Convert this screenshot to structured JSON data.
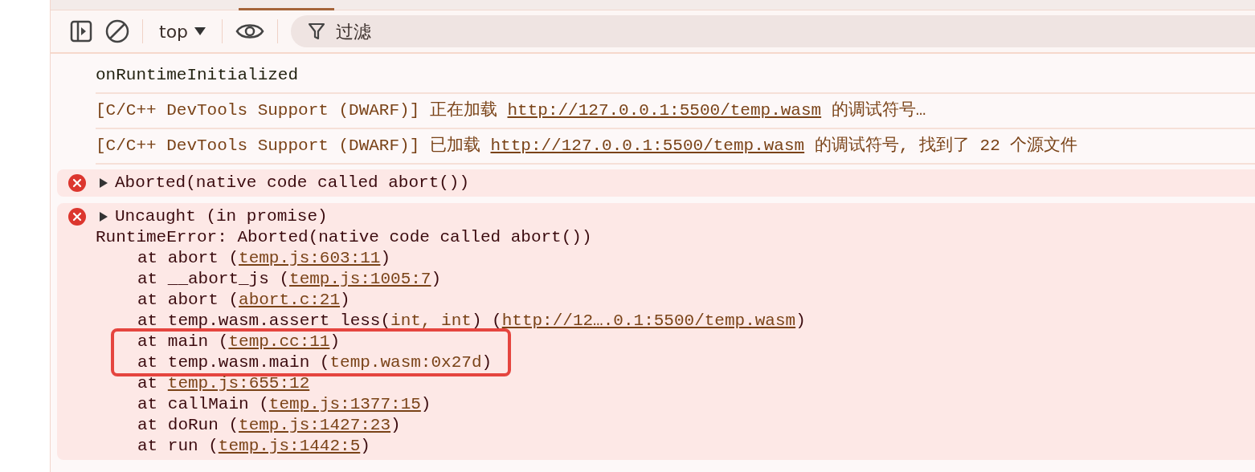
{
  "toolbar": {
    "context": "top",
    "filter": {
      "placeholder": "过滤"
    }
  },
  "messages": [
    {
      "kind": "log",
      "parts": [
        {
          "kind": "text",
          "text": "onRuntimeInitialized"
        }
      ]
    },
    {
      "kind": "system",
      "parts": [
        {
          "kind": "text",
          "text": "[C/C++ DevTools Support (DWARF)] 正在加载 "
        },
        {
          "kind": "link",
          "text": "http://127.0.0.1:5500/temp.wasm"
        },
        {
          "kind": "text",
          "text": " 的调试符号…"
        }
      ]
    },
    {
      "kind": "system",
      "parts": [
        {
          "kind": "text",
          "text": "[C/C++ DevTools Support (DWARF)] 已加载 "
        },
        {
          "kind": "link",
          "text": "http://127.0.0.1:5500/temp.wasm"
        },
        {
          "kind": "text",
          "text": " 的调试符号, 找到了 22 个源文件"
        }
      ]
    },
    {
      "kind": "error",
      "expanded": false,
      "summary": "Aborted(native code called abort())"
    },
    {
      "kind": "error",
      "expanded": false,
      "summary": "Uncaught (in promise)",
      "detail": "RuntimeError: Aborted(native code called abort())",
      "stack": [
        {
          "highlighted": false,
          "parts": [
            {
              "kind": "text",
              "text": "at abort ("
            },
            {
              "kind": "link",
              "text": "temp.js:603:11"
            },
            {
              "kind": "text",
              "text": ")"
            }
          ]
        },
        {
          "highlighted": false,
          "parts": [
            {
              "kind": "text",
              "text": "at __abort_js ("
            },
            {
              "kind": "link",
              "text": "temp.js:1005:7"
            },
            {
              "kind": "text",
              "text": ")"
            }
          ]
        },
        {
          "highlighted": false,
          "parts": [
            {
              "kind": "text",
              "text": "at abort ("
            },
            {
              "kind": "link",
              "text": "abort.c:21"
            },
            {
              "kind": "text",
              "text": ")"
            }
          ]
        },
        {
          "highlighted": false,
          "parts": [
            {
              "kind": "text",
              "text": "at temp.wasm.assert less("
            },
            {
              "kind": "arg",
              "text": "int, int"
            },
            {
              "kind": "text",
              "text": ") ("
            },
            {
              "kind": "link",
              "text": "http://12….0.1:5500/temp.wasm"
            },
            {
              "kind": "text",
              "text": ")"
            }
          ]
        },
        {
          "highlighted": true,
          "parts": [
            {
              "kind": "text",
              "text": "at main ("
            },
            {
              "kind": "link",
              "text": "temp.cc:11"
            },
            {
              "kind": "text",
              "text": ")"
            }
          ]
        },
        {
          "highlighted": true,
          "parts": [
            {
              "kind": "text",
              "text": "at temp.wasm.main ("
            },
            {
              "kind": "arg",
              "text": "temp.wasm:0x27d"
            },
            {
              "kind": "text",
              "text": ")"
            }
          ]
        },
        {
          "highlighted": false,
          "parts": [
            {
              "kind": "text",
              "text": "at "
            },
            {
              "kind": "link",
              "text": "temp.js:655:12"
            }
          ]
        },
        {
          "highlighted": false,
          "parts": [
            {
              "kind": "text",
              "text": "at callMain ("
            },
            {
              "kind": "link",
              "text": "temp.js:1377:15"
            },
            {
              "kind": "text",
              "text": ")"
            }
          ]
        },
        {
          "highlighted": false,
          "parts": [
            {
              "kind": "text",
              "text": "at doRun ("
            },
            {
              "kind": "link",
              "text": "temp.js:1427:23"
            },
            {
              "kind": "text",
              "text": ")"
            }
          ]
        },
        {
          "highlighted": false,
          "parts": [
            {
              "kind": "text",
              "text": "at run ("
            },
            {
              "kind": "link",
              "text": "temp.js:1442:5"
            },
            {
              "kind": "text",
              "text": ")"
            }
          ]
        }
      ]
    }
  ]
}
